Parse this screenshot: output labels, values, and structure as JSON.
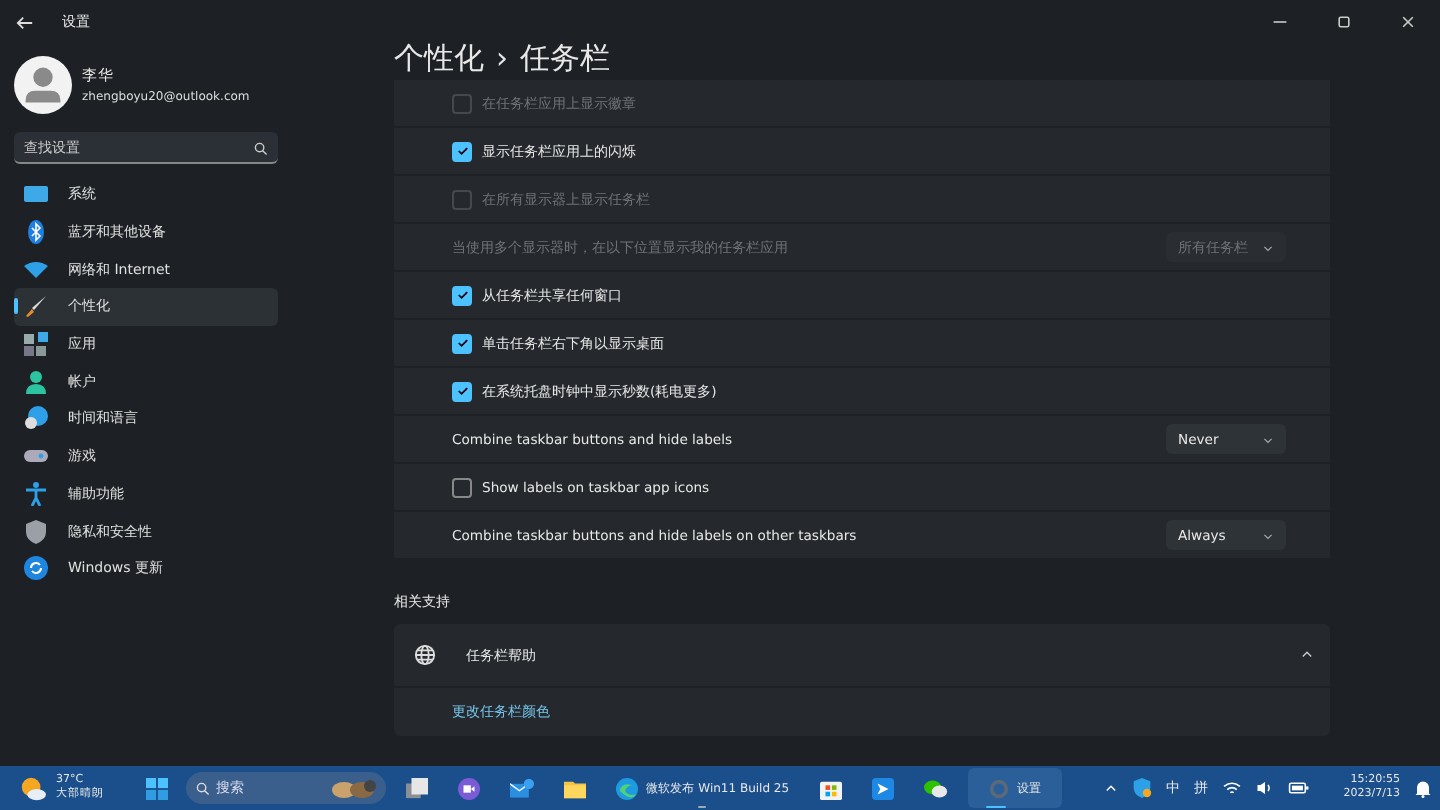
{
  "window": {
    "title": "设置"
  },
  "user": {
    "name": "李华",
    "email": "zhengboyu20@outlook.com"
  },
  "search": {
    "placeholder": "查找设置"
  },
  "sidebar": {
    "items": [
      {
        "label": "系统",
        "selected": false
      },
      {
        "label": "蓝牙和其他设备",
        "selected": false
      },
      {
        "label": "网络和 Internet",
        "selected": false
      },
      {
        "label": "个性化",
        "selected": true
      },
      {
        "label": "应用",
        "selected": false
      },
      {
        "label": "帐户",
        "selected": false
      },
      {
        "label": "时间和语言",
        "selected": false
      },
      {
        "label": "游戏",
        "selected": false
      },
      {
        "label": "辅助功能",
        "selected": false
      },
      {
        "label": "隐私和安全性",
        "selected": false
      },
      {
        "label": "Windows 更新",
        "selected": false
      }
    ]
  },
  "breadcrumb": {
    "parent": "个性化",
    "separator": "›",
    "current": "任务栏"
  },
  "rows": [
    {
      "kind": "checkbox",
      "label": "在任务栏应用上显示徽章",
      "checked": false,
      "disabled": true
    },
    {
      "kind": "checkbox",
      "label": "显示任务栏应用上的闪烁",
      "checked": true,
      "disabled": false
    },
    {
      "kind": "checkbox",
      "label": "在所有显示器上显示任务栏",
      "checked": false,
      "disabled": true
    },
    {
      "kind": "dropdown",
      "label": "当使用多个显示器时，在以下位置显示我的任务栏应用",
      "value": "所有任务栏",
      "disabled": true
    },
    {
      "kind": "checkbox",
      "label": "从任务栏共享任何窗口",
      "checked": true,
      "disabled": false
    },
    {
      "kind": "checkbox",
      "label": "单击任务栏右下角以显示桌面",
      "checked": true,
      "disabled": false
    },
    {
      "kind": "checkbox",
      "label": "在系统托盘时钟中显示秒数(耗电更多)",
      "checked": true,
      "disabled": false
    },
    {
      "kind": "dropdown",
      "label": "Combine taskbar buttons and hide labels",
      "value": "Never",
      "disabled": false
    },
    {
      "kind": "checkbox",
      "label": "Show labels on taskbar app icons",
      "checked": false,
      "disabled": false
    },
    {
      "kind": "dropdown",
      "label": "Combine taskbar buttons and hide labels on other taskbars",
      "value": "Always",
      "disabled": false
    }
  ],
  "related": {
    "heading": "相关支持",
    "title": "任务栏帮助",
    "expanded": true,
    "link": "更改任务栏颜色"
  },
  "taskbar": {
    "weather": {
      "temp": "37°C",
      "desc": "大部晴朗"
    },
    "search": {
      "placeholder": "搜索"
    },
    "apps": [
      {
        "kind": "taskview",
        "running": false,
        "active": false
      },
      {
        "kind": "video",
        "running": false,
        "active": false
      },
      {
        "kind": "mail",
        "running": false,
        "active": false
      },
      {
        "kind": "folder",
        "running": false,
        "active": false
      },
      {
        "kind": "browser",
        "label": "微软发布 Win11 Build 25",
        "running": true,
        "active": false
      },
      {
        "kind": "store",
        "running": false,
        "active": false
      },
      {
        "kind": "pen",
        "running": false,
        "active": false
      },
      {
        "kind": "chat",
        "running": false,
        "active": false
      },
      {
        "kind": "gear",
        "label": "设置",
        "running": true,
        "active": true
      }
    ],
    "tray": {
      "ime": [
        "中",
        "拼"
      ],
      "time": "15:20:55",
      "date": "2023/7/13"
    }
  }
}
